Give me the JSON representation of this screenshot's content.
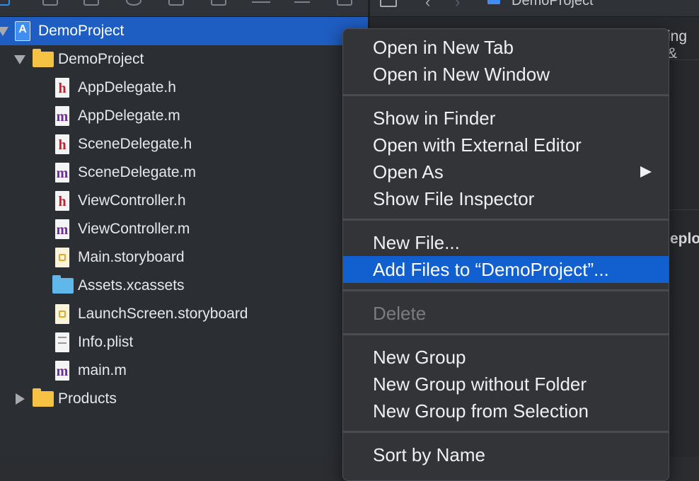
{
  "navigator": {
    "rows": [
      {
        "label": "DemoProject"
      },
      {
        "label": "DemoProject"
      },
      {
        "label": "AppDelegate.h"
      },
      {
        "label": "AppDelegate.m"
      },
      {
        "label": "SceneDelegate.h"
      },
      {
        "label": "SceneDelegate.m"
      },
      {
        "label": "ViewController.h"
      },
      {
        "label": "ViewController.m"
      },
      {
        "label": "Main.storyboard"
      },
      {
        "label": "Assets.xcassets"
      },
      {
        "label": "LaunchScreen.storyboard"
      },
      {
        "label": "Info.plist"
      },
      {
        "label": "main.m"
      },
      {
        "label": "Products"
      }
    ],
    "icons": {
      "h": "h",
      "m": "m"
    }
  },
  "editor": {
    "jump_bar_title": "DemoProject",
    "edge_text_1": "ing &",
    "edge_text_2": "eplo"
  },
  "context_menu": {
    "items": [
      {
        "label": "Open in New Tab"
      },
      {
        "label": "Open in New Window"
      },
      {
        "label": "Show in Finder"
      },
      {
        "label": "Open with External Editor"
      },
      {
        "label": "Open As"
      },
      {
        "label": "Show File Inspector"
      },
      {
        "label": "New File..."
      },
      {
        "label": "Add Files to “DemoProject”..."
      },
      {
        "label": "Delete"
      },
      {
        "label": "New Group"
      },
      {
        "label": "New Group without Folder"
      },
      {
        "label": "New Group from Selection"
      },
      {
        "label": "Sort by Name"
      }
    ]
  },
  "colors": {
    "selection": "#1e5dc2",
    "menu_highlight": "#1260cf",
    "folder": "#f6c243",
    "assets_folder": "#5fb7ea"
  }
}
